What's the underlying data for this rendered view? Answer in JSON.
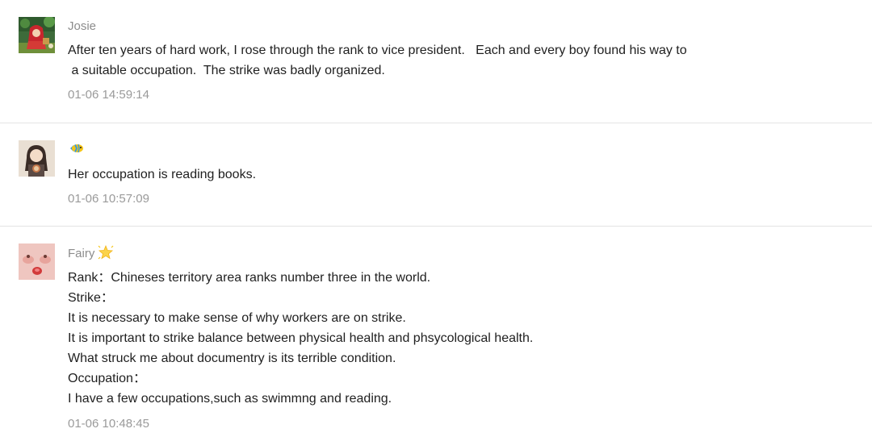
{
  "comments": [
    {
      "author": "Josie",
      "avatar": "avatar-red-riding-hood",
      "lines": [
        "After ten years of hard work, I rose through the rank to vice president.   Each and every boy found his way to",
        " a suitable occupation.  The strike was badly organized."
      ],
      "timestamp": "01-06 14:59:14"
    },
    {
      "author": "",
      "author_icon": "tropical-fish-icon",
      "avatar": "avatar-girl-with-cup",
      "lines": [
        "Her occupation is reading books."
      ],
      "timestamp": "01-06 10:57:09"
    },
    {
      "author": "Fairy",
      "author_icon": "glowing-star-icon",
      "avatar": "avatar-blushing-face",
      "lines": [
        "Rank：Chineses territory area ranks number three in the world.",
        "Strike：",
        "It is necessary to make sense of why workers are on strike.",
        "It is important to strike balance between physical health and phsycological health.",
        "What struck me about documentry is its terrible condition.",
        "Occupation：",
        "I have a few occupations,such as swimmng and reading."
      ],
      "timestamp": "01-06 10:48:45"
    }
  ]
}
